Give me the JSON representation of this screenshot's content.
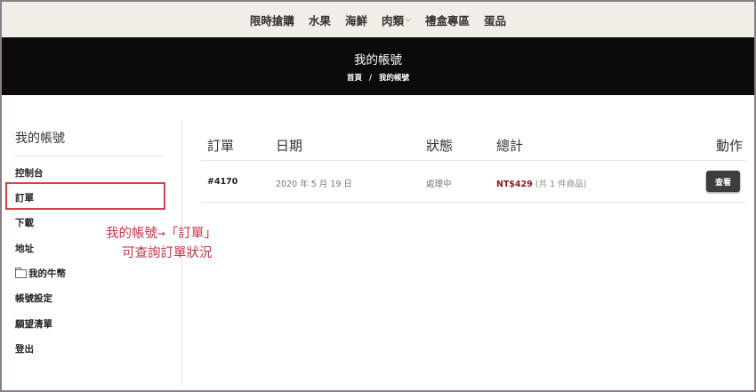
{
  "topnav": {
    "items": [
      "限時搶購",
      "水果",
      "海鮮",
      "肉類",
      "禮盒專區",
      "蛋品"
    ],
    "dropdown_icon": "chevron-down-icon"
  },
  "hero": {
    "title": "我的帳號",
    "breadcrumb_home": "首頁",
    "breadcrumb_separator": "/",
    "breadcrumb_current": "我的帳號"
  },
  "sidebar": {
    "heading": "我的帳號",
    "items": [
      "控制台",
      "訂單",
      "下載",
      "地址",
      "我的牛幣",
      "帳號設定",
      "願望清單",
      "登出"
    ],
    "wallet_icon": "folder-icon"
  },
  "annotation": {
    "line1": "我的帳號→「訂單」",
    "line2": "可查詢訂單狀況",
    "color": "#c4364a"
  },
  "orders": {
    "headers": {
      "order": "訂單",
      "date": "日期",
      "status": "狀態",
      "total": "總計",
      "action": "動作"
    },
    "rows": [
      {
        "order_no": "#4170",
        "date": "2020 年 5 月 19 日",
        "status": "處理中",
        "amount": "NT$429",
        "qty": "(共 1 件商品)",
        "action": "查看"
      }
    ]
  },
  "colors": {
    "nav_bg": "#f1eee7",
    "hero_bg": "#0b0b0b",
    "price": "#8b1a1a",
    "button_bg": "#3d3d3d",
    "highlight_border": "#d3424a"
  }
}
